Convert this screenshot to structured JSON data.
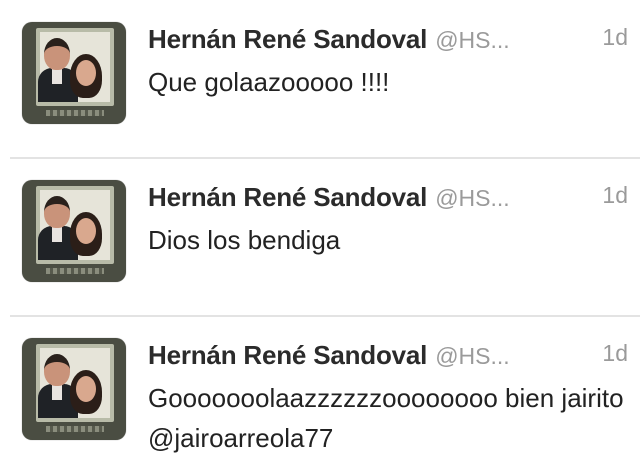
{
  "tweets": [
    {
      "author_name": "Hernán René Sandoval",
      "handle": "@HS...",
      "time": "1d",
      "text": "Que golaazooooo !!!!"
    },
    {
      "author_name": "Hernán René Sandoval",
      "handle": "@HS...",
      "time": "1d",
      "text": "Dios los bendiga"
    },
    {
      "author_name": "Hernán René Sandoval",
      "handle": "@HS...",
      "time": "1d",
      "text": "Gooooooolaazzzzzzoooooooo bien jairito @jairoarreola77"
    }
  ],
  "colors": {
    "name": "#2b2b2b",
    "meta": "#9a9a9a",
    "text": "#222222",
    "divider": "#e3e3e3"
  },
  "icons": {
    "avatar": "profile-photo"
  }
}
